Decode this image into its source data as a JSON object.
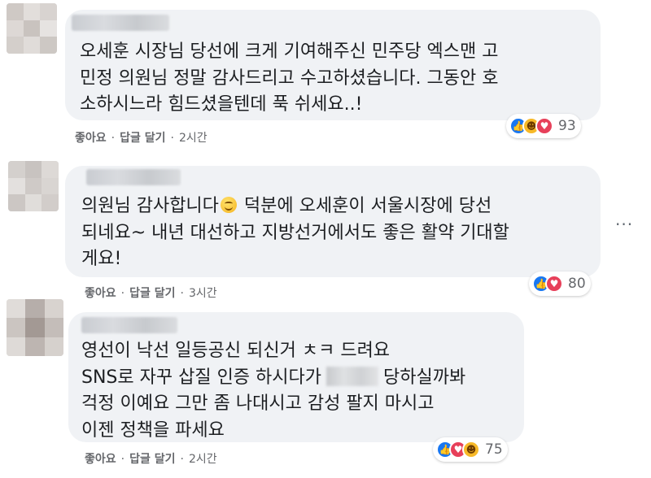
{
  "comments": [
    {
      "lines": [
        "오세훈 시장님 당선에 크게 기여해주신 민주당 엑스맨 고",
        "민정 의원님 정말 감사드리고 수고하셨습니다. 그동안 호",
        "소하시느라 힘드셨을텐데 푹 쉬세요..!"
      ],
      "like_label": "좋아요",
      "reply_label": "답글 달기",
      "time": "2시간",
      "reactions": [
        "like",
        "haha",
        "love"
      ],
      "reaction_count": "93"
    },
    {
      "line1_before": "의원님 감사합니다",
      "line1_after": " 덕분에 오세훈이 서울시장에 당선",
      "lines_rest": [
        "되네요~ 내년 대선하고 지방선거에서도 좋은 활약 기대할",
        "게요!"
      ],
      "like_label": "좋아요",
      "reply_label": "답글 달기",
      "time": "3시간",
      "reactions": [
        "like",
        "love"
      ],
      "reaction_count": "80"
    },
    {
      "line1": "영선이 낙선 일등공신 되신거 ㅊㅋ 드려요",
      "line2_before": "SNS로 자꾸 삽질 인증 하시다가",
      "line2_after": "당하실까봐",
      "lines_rest": [
        "걱정 이예요 그만 좀 나대시고 감성 팔지 마시고",
        "이젠 정책을 파세요"
      ],
      "like_label": "좋아요",
      "reply_label": "답글 달기",
      "time": "2시간",
      "reactions": [
        "like",
        "love",
        "haha"
      ],
      "reaction_count": "75"
    }
  ],
  "more_options_icon": "more-horizontal-icon",
  "colors": {
    "bubble": "#f0f2f5",
    "meta_text": "#65676b",
    "like": "#1877f2",
    "love": "#e7405a",
    "haha": "#f7b928"
  }
}
